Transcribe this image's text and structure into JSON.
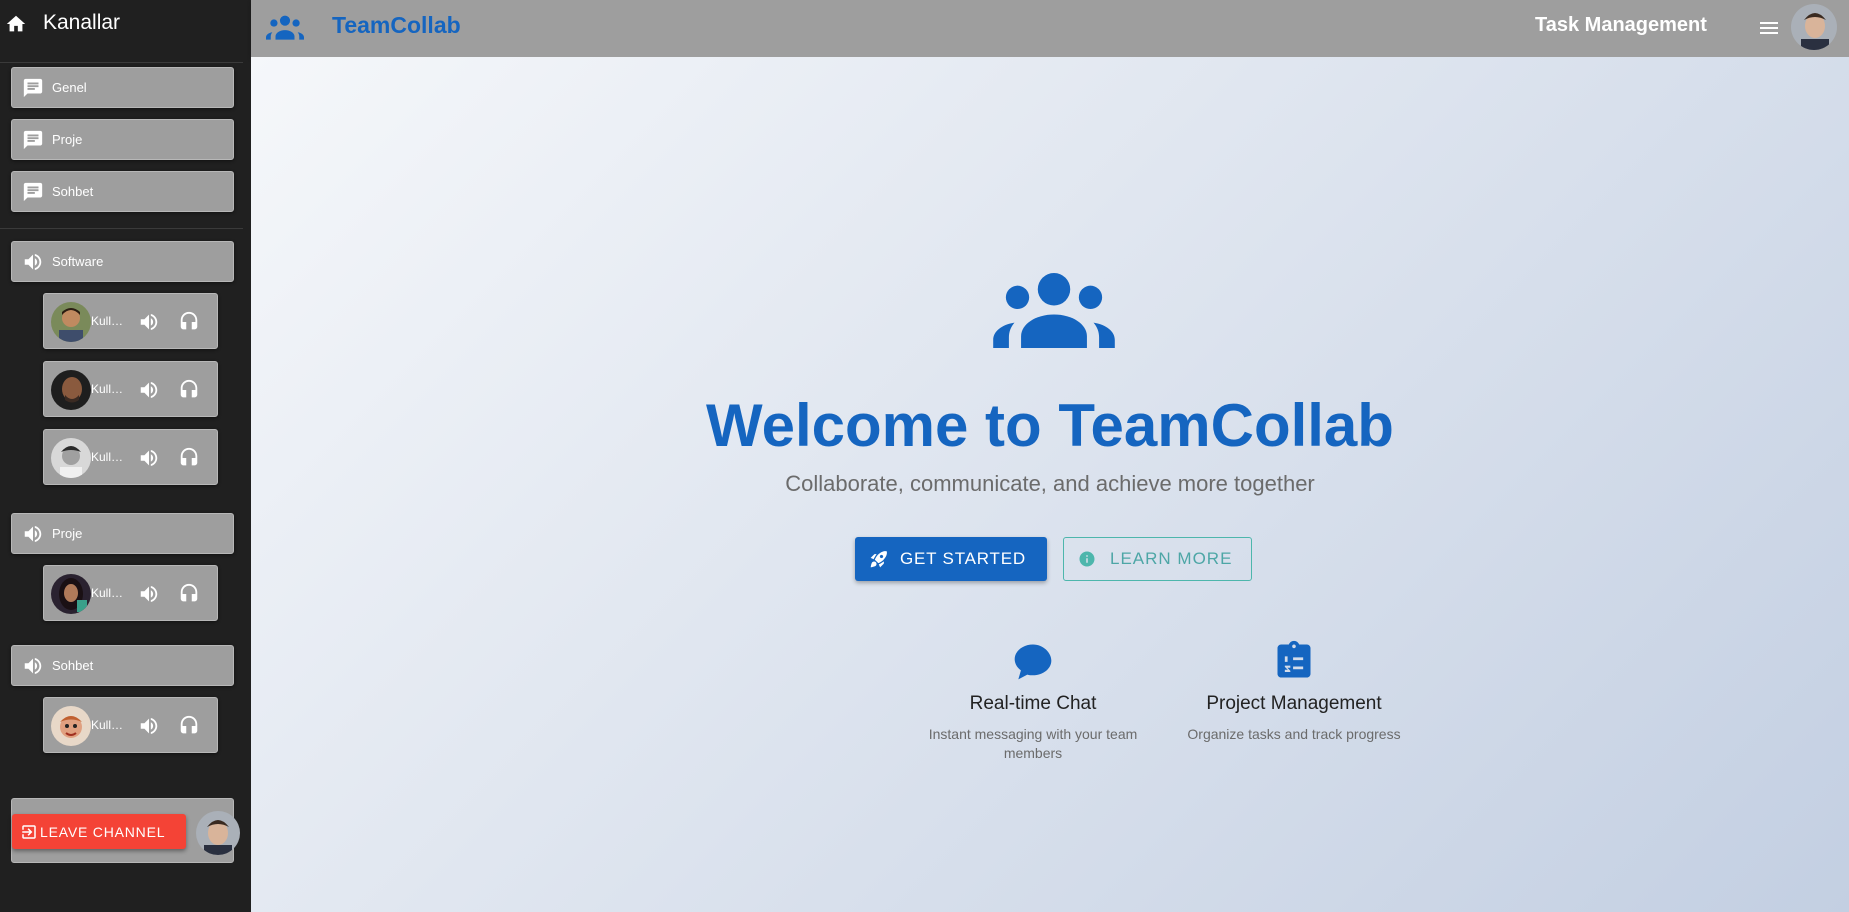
{
  "sidebar": {
    "title": "Kanallar",
    "text_channels": [
      {
        "label": "Genel"
      },
      {
        "label": "Proje"
      },
      {
        "label": "Sohbet"
      }
    ],
    "voice_channels": [
      {
        "label": "Software",
        "users": [
          "Kullanıcı",
          "Kullanıcı",
          "Kullanıcı"
        ]
      },
      {
        "label": "Proje",
        "users": [
          "Kullanıcı"
        ]
      },
      {
        "label": "Sohbet",
        "users": [
          "Kullanıcı"
        ]
      }
    ],
    "leave_button": "LEAVE CHANNEL"
  },
  "topbar": {
    "brand": "TeamCollab",
    "section_title": "Task Management"
  },
  "hero": {
    "title": "Welcome to TeamCollab",
    "subtitle": "Collaborate, communicate, and achieve more together",
    "primary_button": "GET STARTED",
    "secondary_button": "LEARN MORE"
  },
  "features": [
    {
      "title": "Real-time Chat",
      "description": "Instant messaging with your team members",
      "icon": "chat-bubble-icon"
    },
    {
      "title": "Project Management",
      "description": "Organize tasks and track progress",
      "icon": "assignment-icon"
    }
  ],
  "colors": {
    "primary": "#1565c0",
    "danger": "#f44336",
    "teal": "#4db6ac",
    "sidebar_bg": "#202020",
    "card_bg": "#9e9e9e"
  }
}
